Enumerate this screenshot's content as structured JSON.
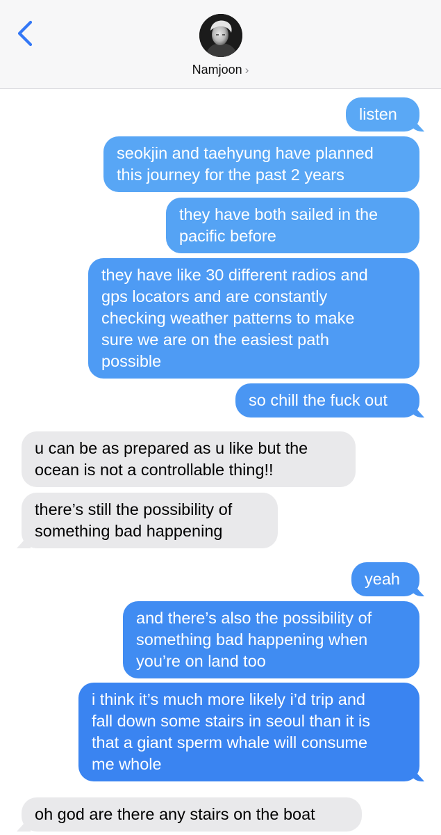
{
  "header": {
    "contact_name": "Namjoon",
    "chevron": "›",
    "back_icon": "chevron-left-icon",
    "avatar_icon": "contact-avatar"
  },
  "colors": {
    "accent": "#3478f6",
    "sent_top": "#5eaaf5",
    "sent_bottom": "#3a7ff1",
    "received": "#e9e9eb",
    "header_bg": "#f7f7f8"
  },
  "messages": [
    {
      "from": "me",
      "text": "listen"
    },
    {
      "from": "me",
      "text": "seokjin and taehyung have planned\nthis journey for the past 2 years"
    },
    {
      "from": "me",
      "text": "they have both sailed in the\npacific before"
    },
    {
      "from": "me",
      "text": "they have like 30 different radios and\ngps locators and are constantly\nchecking weather patterns to make\nsure we are on the easiest path\npossible"
    },
    {
      "from": "me",
      "text": "so chill the fuck out"
    },
    {
      "from": "them",
      "text": "u can be as prepared as u like but the\nocean is not a controllable thing!!"
    },
    {
      "from": "them",
      "text": "there’s still the possibility of\nsomething bad happening"
    },
    {
      "from": "me",
      "text": "yeah"
    },
    {
      "from": "me",
      "text": "and there’s also the possibility of\nsomething bad happening when\nyou’re on land too"
    },
    {
      "from": "me",
      "text": "i think it’s much more likely i’d trip and\nfall down some stairs in seoul than it is\nthat a giant sperm whale will consume\nme whole"
    },
    {
      "from": "them",
      "text": "oh god are there any stairs on the boat"
    }
  ]
}
